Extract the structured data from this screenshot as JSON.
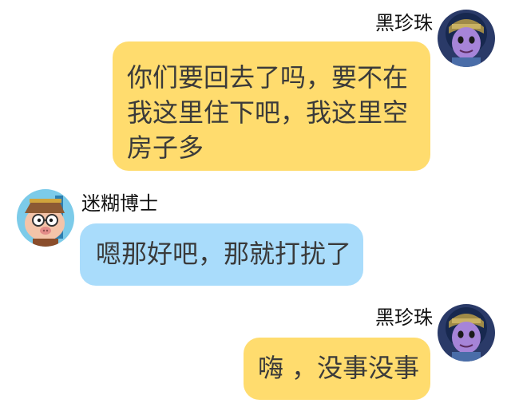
{
  "messages": [
    {
      "sender": "黑珍珠",
      "side": "right",
      "text": "你们要回去了吗，要不在我这里住下吧，我这里空房子多",
      "bubble_color": "#ffdc6e",
      "avatar_icon": "purple-character-avatar"
    },
    {
      "sender": "迷糊博士",
      "side": "left",
      "text": "嗯那好吧，那就打扰了",
      "bubble_color": "#a9dcfb",
      "avatar_icon": "pig-doctor-avatar"
    },
    {
      "sender": "黑珍珠",
      "side": "right",
      "text": "嗨 ，没事没事",
      "bubble_color": "#ffdc6e",
      "avatar_icon": "purple-character-avatar"
    }
  ]
}
